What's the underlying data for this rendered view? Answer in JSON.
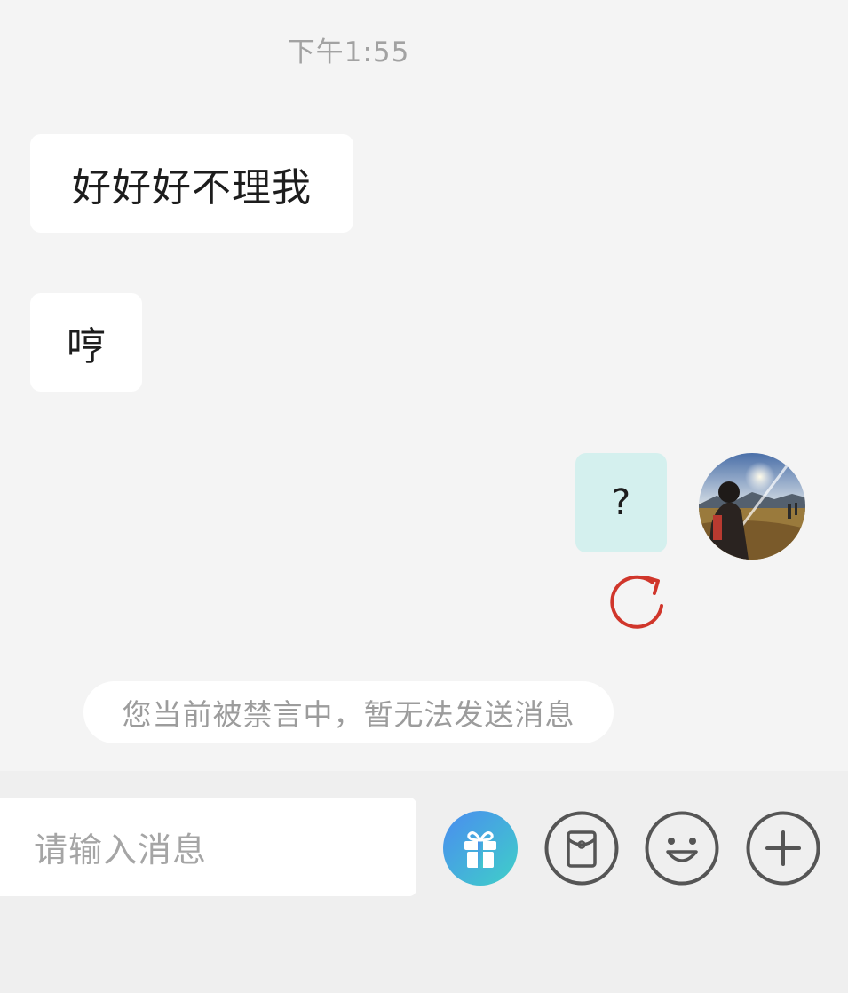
{
  "chat": {
    "timestamp": "下午1:55",
    "messages": [
      {
        "side": "left",
        "text": "好好好不理我"
      },
      {
        "side": "left",
        "text": "哼"
      },
      {
        "side": "right",
        "text": "?",
        "status": "failed"
      }
    ],
    "mute_notice": "您当前被禁言中，暂无法发送消息"
  },
  "input": {
    "placeholder": "请输入消息"
  },
  "toolbar": {
    "icons": [
      "gift-icon",
      "red-packet-icon",
      "emoji-icon",
      "plus-icon"
    ]
  },
  "colors": {
    "background": "#f4f4f4",
    "my_bubble": "#d4f0ee",
    "retry_red": "#d0362b",
    "gift_gradient_start": "#4a8cf0",
    "gift_gradient_end": "#3fd0c8"
  }
}
